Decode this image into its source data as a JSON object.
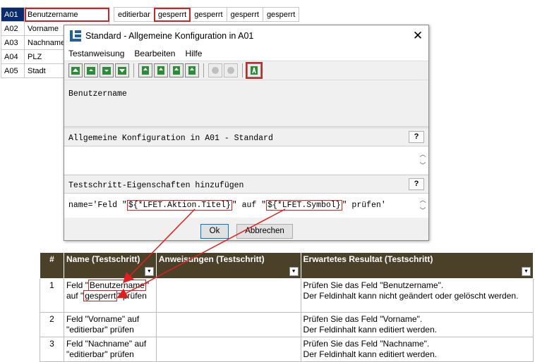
{
  "sheet_rows": [
    {
      "id": "A01",
      "name": "Benutzername"
    },
    {
      "id": "A02",
      "name": "Vorname"
    },
    {
      "id": "A03",
      "name": "Nachname"
    },
    {
      "id": "A04",
      "name": "PLZ"
    },
    {
      "id": "A05",
      "name": "Stadt"
    }
  ],
  "state_cells": [
    "editierbar",
    "gesperrt",
    "gesperrt",
    "gesperrt",
    "gesperrt"
  ],
  "dialog": {
    "title": "Standard - Allgemeine Konfiguration in A01",
    "close_glyph": "✕",
    "menu": [
      "Testanweisung",
      "Bearbeiten",
      "Hilfe"
    ],
    "section1_text": "Benutzername",
    "section2_head": "Allgemeine Konfiguration in A01 - Standard",
    "section3_head": "Testschritt-Eigenschaften hinzufügen",
    "help_glyph": "?",
    "expr_pre": "name='Feld \"",
    "expr_var1": "${*LFET.Aktion.Titel}",
    "expr_mid": "\" auf \"",
    "expr_var2": "${*LFET.Symbol}",
    "expr_post": "\" prüfen'",
    "ok": "Ok",
    "cancel": "Abbrechen"
  },
  "table": {
    "headers": [
      "#",
      "Name (Testschritt)",
      "Anweisungen (Testschritt)",
      "Erwartetes Resultat (Testschritt)"
    ],
    "rows": [
      {
        "num": "1",
        "name_a": "Feld \"",
        "name_hl1": "Benutzername",
        "name_b": "\"",
        "name_c": "auf \"",
        "name_hl2": "gesperrt",
        "name_d": "\" prüfen",
        "result1": "Prüfen Sie das Feld \"Benutzername\".",
        "result2": "Der Feldinhalt kann nicht geändert oder gelöscht werden."
      },
      {
        "num": "2",
        "name1": "Feld \"Vorname\" auf",
        "name2": "\"editierbar\" prüfen",
        "result1": "Prüfen Sie das Feld \"Vorname\".",
        "result2": "Der Feldinhalt kann editiert werden."
      },
      {
        "num": "3",
        "name1": "Feld \"Nachname\" auf",
        "name2": "\"editierbar\" prüfen",
        "result1": "Prüfen Sie das Feld \"Nachname\".",
        "result2": "Der Feldinhalt kann editiert werden."
      }
    ]
  },
  "colors": {
    "highlight": "#c62828",
    "header_bg": "#4a4128",
    "selected_id": "#0a2b6e"
  }
}
